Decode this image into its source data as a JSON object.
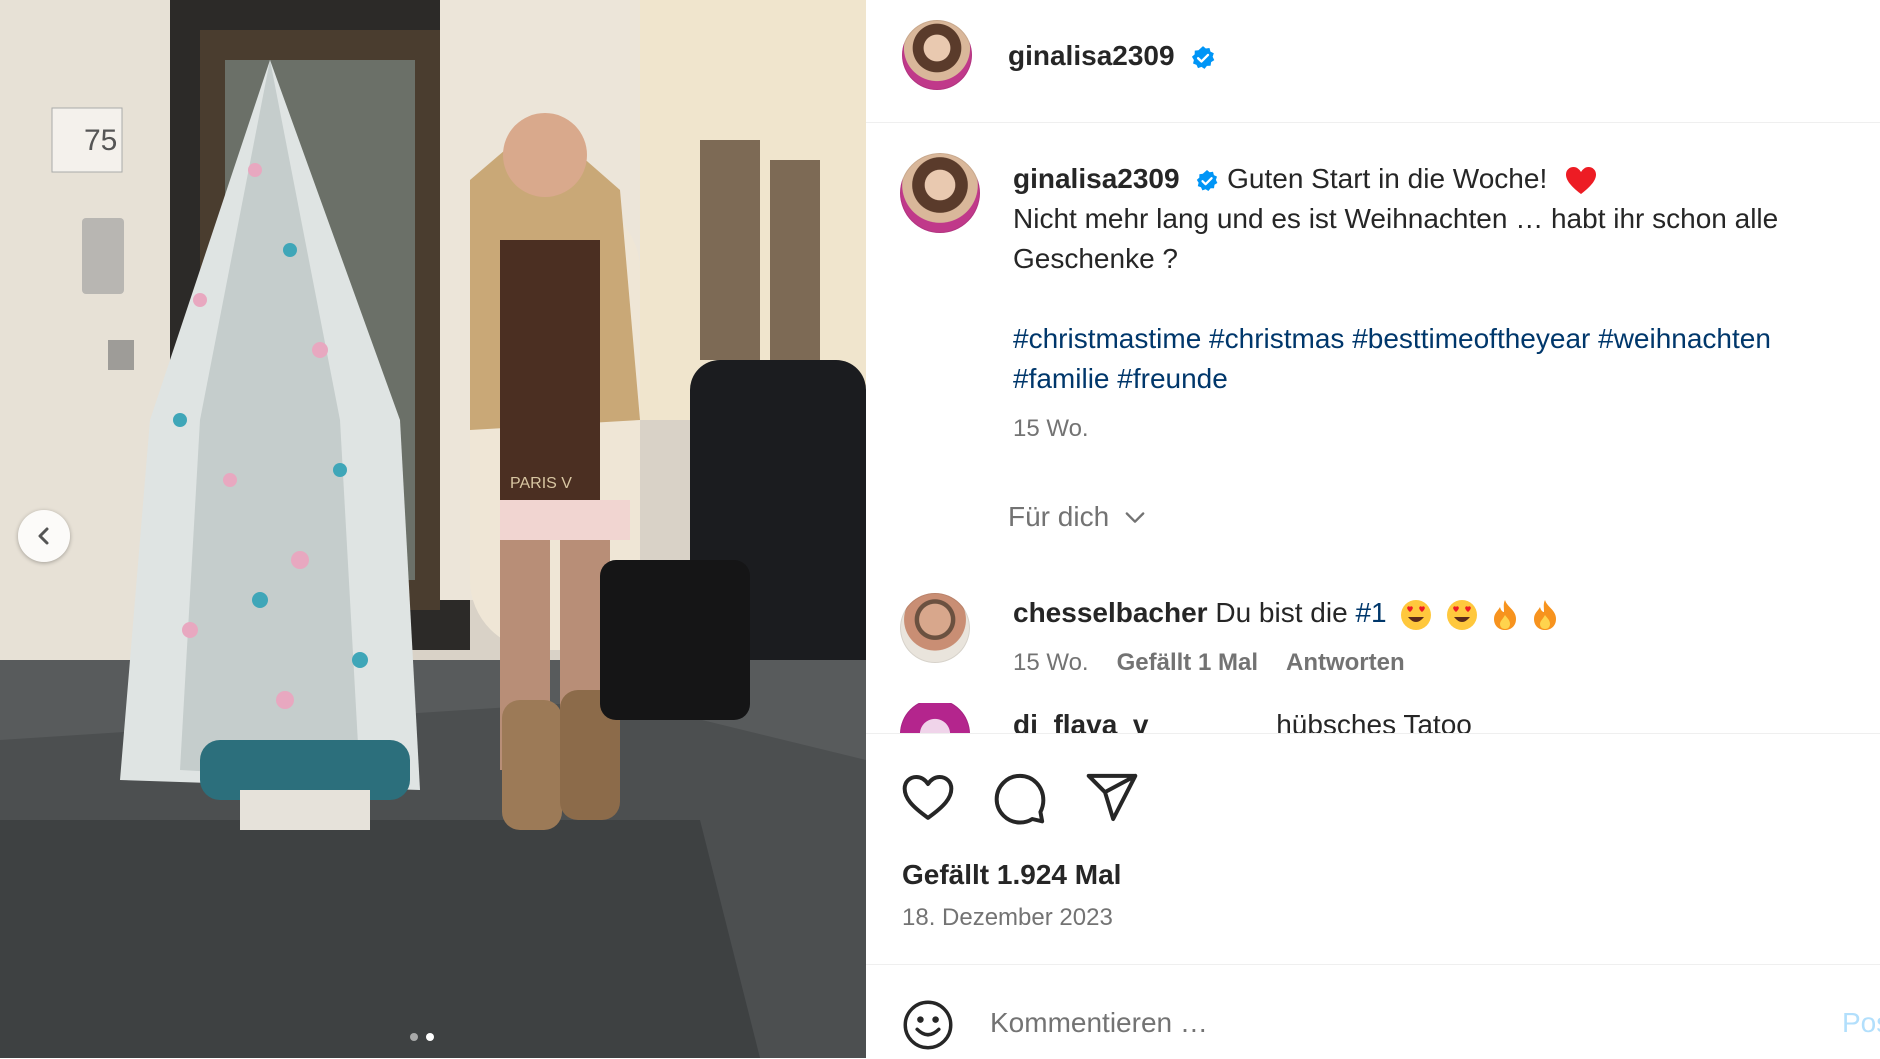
{
  "post": {
    "username": "ginalisa2309",
    "verified": true
  },
  "caption": {
    "username": "ginalisa2309",
    "line1": "Guten Start in die Woche!",
    "line2": "Nicht mehr lang und es ist Weihnachten … habt ihr schon alle Geschenke ?",
    "hashtags_line1": [
      "#christmastime",
      "#christmas",
      "#besttimeoftheyear",
      "#weihnachten"
    ],
    "hashtags_line2": [
      "#familie",
      "#freunde"
    ],
    "time": "15 Wo."
  },
  "for_you": {
    "label": "Für dich"
  },
  "comments": [
    {
      "username": "chesselbacher",
      "text": "Du bist die",
      "tag": "#1",
      "time": "15 Wo.",
      "likes": "Gefällt 1 Mal",
      "reply": "Antworten"
    },
    {
      "username": "dj_flava_v",
      "text": "hübsches Tatoo"
    }
  ],
  "stats": {
    "likes": "Gefällt 1.924 Mal",
    "date": "18. Dezember 2023"
  },
  "composer": {
    "placeholder": "Kommentieren …",
    "post_label": "Posten"
  },
  "carousel": {
    "count": 2,
    "active_index": 1
  },
  "photo_signs": {
    "house_number": "75",
    "scarf_text": "PARIS V"
  },
  "colors": {
    "accent_blue": "#0095f6",
    "hashtag": "#00376b",
    "muted_text": "#737373",
    "verified": "#0095f6",
    "heart_red": "#ed1c24"
  },
  "icons": [
    "chevron-left-icon",
    "verified-badge-icon",
    "red-heart-emoji",
    "heart-eyes-emoji",
    "fire-emoji",
    "chevron-down-icon",
    "like-icon",
    "comment-icon",
    "share-icon",
    "emoji-icon"
  ]
}
